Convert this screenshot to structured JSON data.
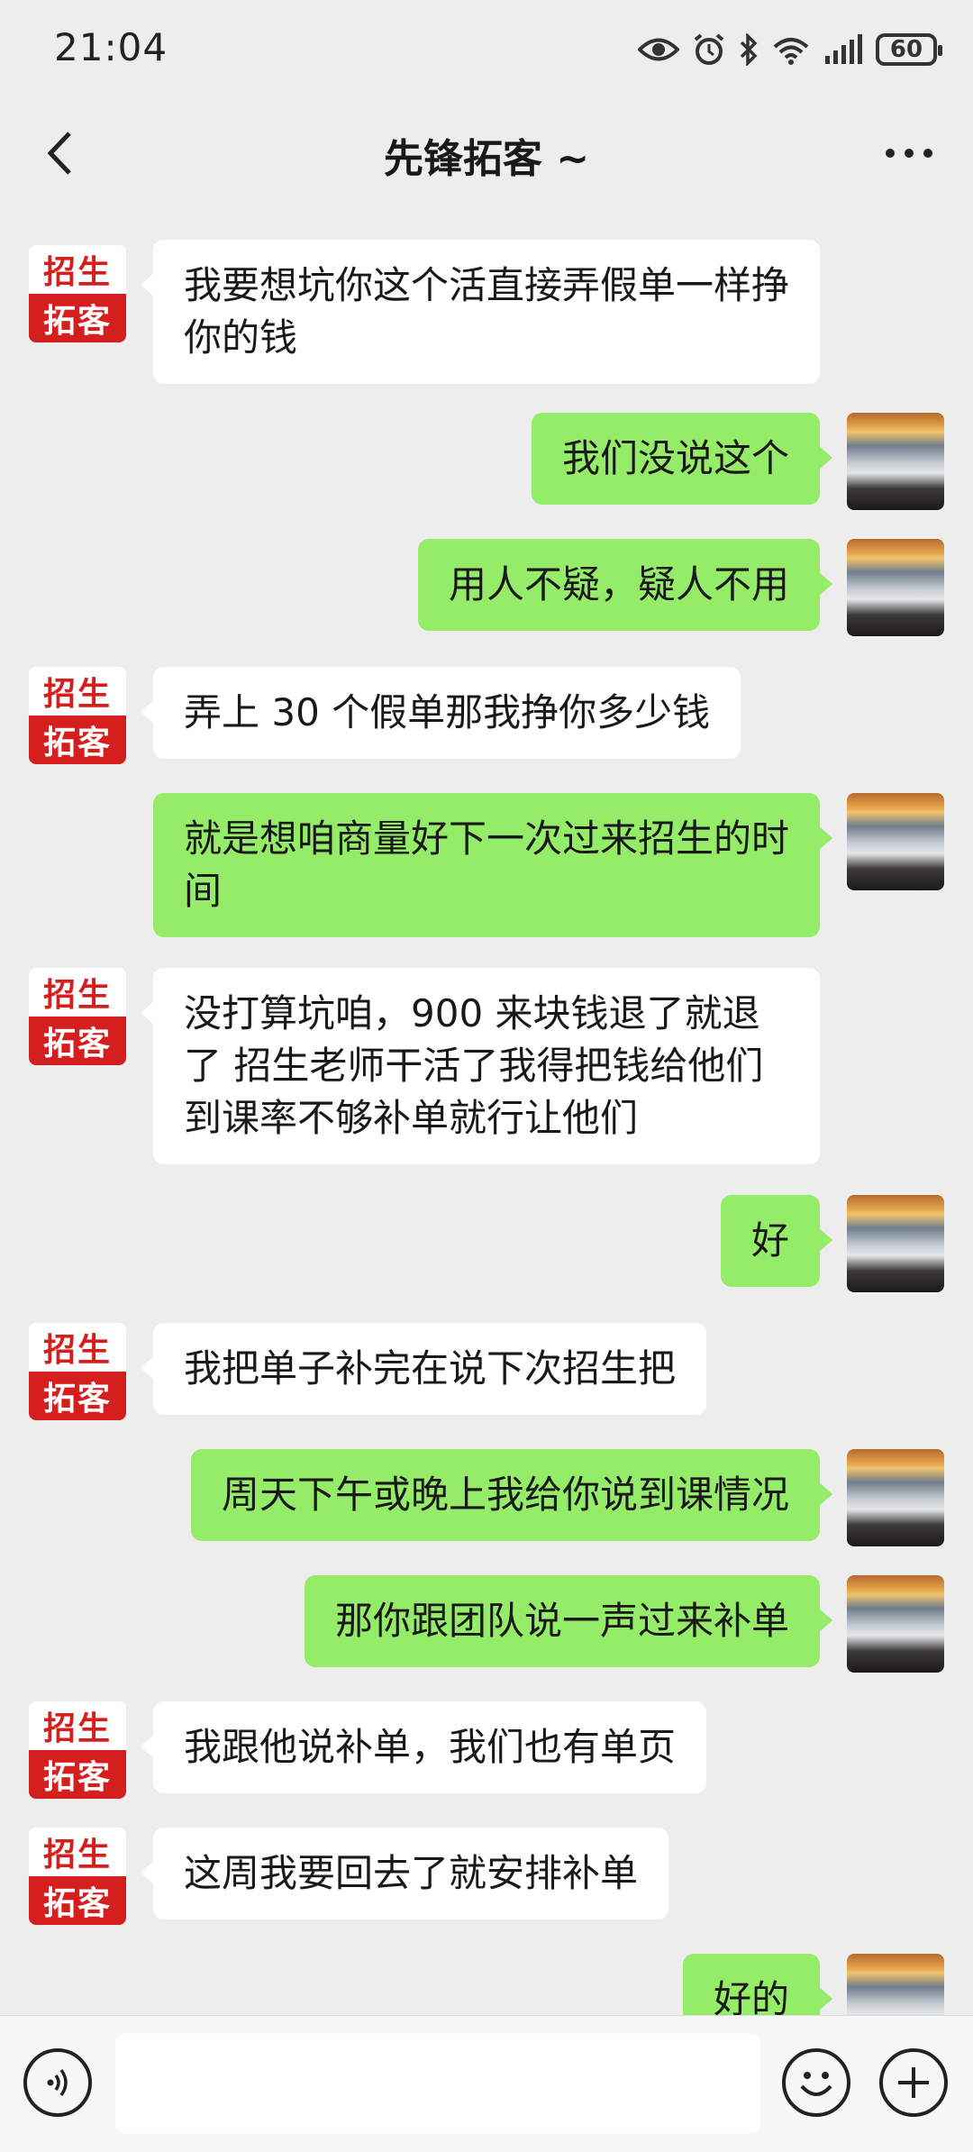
{
  "status_bar": {
    "time": "21:04",
    "battery": "60",
    "icons": [
      "eye-icon",
      "alarm-icon",
      "bluetooth-icon",
      "wifi-icon",
      "signal-icon",
      "battery-icon"
    ]
  },
  "header": {
    "title": "先锋拓客 ~",
    "back_icon": "chevron-left-icon",
    "more_icon": "more-dots-icon"
  },
  "contact_avatar": {
    "line1": "招生",
    "line2": "拓客",
    "colors": {
      "red": "#d51f1f",
      "white": "#ffffff"
    }
  },
  "messages": [
    {
      "side": "left",
      "text": "我要想坑你这个活直接弄假单一样挣你的钱"
    },
    {
      "side": "right",
      "text": "我们没说这个"
    },
    {
      "side": "right",
      "text": "用人不疑，疑人不用"
    },
    {
      "side": "left",
      "text": "弄上 30 个假单那我挣你多少钱"
    },
    {
      "side": "right",
      "text": "就是想咱商量好下一次过来招生的时间"
    },
    {
      "side": "left",
      "text": "没打算坑咱，900 来块钱退了就退了  招生老师干活了我得把钱给他们  到课率不够补单就行让他们"
    },
    {
      "side": "right",
      "text": "好"
    },
    {
      "side": "left",
      "text": "我把单子补完在说下次招生把"
    },
    {
      "side": "right",
      "text": "周天下午或晚上我给你说到课情况"
    },
    {
      "side": "right",
      "text": "那你跟团队说一声过来补单"
    },
    {
      "side": "left",
      "text": "我跟他说补单，我们也有单页"
    },
    {
      "side": "left",
      "text": "这周我要回去了就安排补单"
    },
    {
      "side": "right",
      "text": "好的"
    }
  ],
  "input_bar": {
    "voice_icon": "voice-icon",
    "emoji_icon": "emoji-icon",
    "plus_icon": "plus-icon",
    "input_value": ""
  },
  "colors": {
    "background": "#ededed",
    "outgoing_bubble": "#95ec69",
    "incoming_bubble": "#ffffff"
  }
}
